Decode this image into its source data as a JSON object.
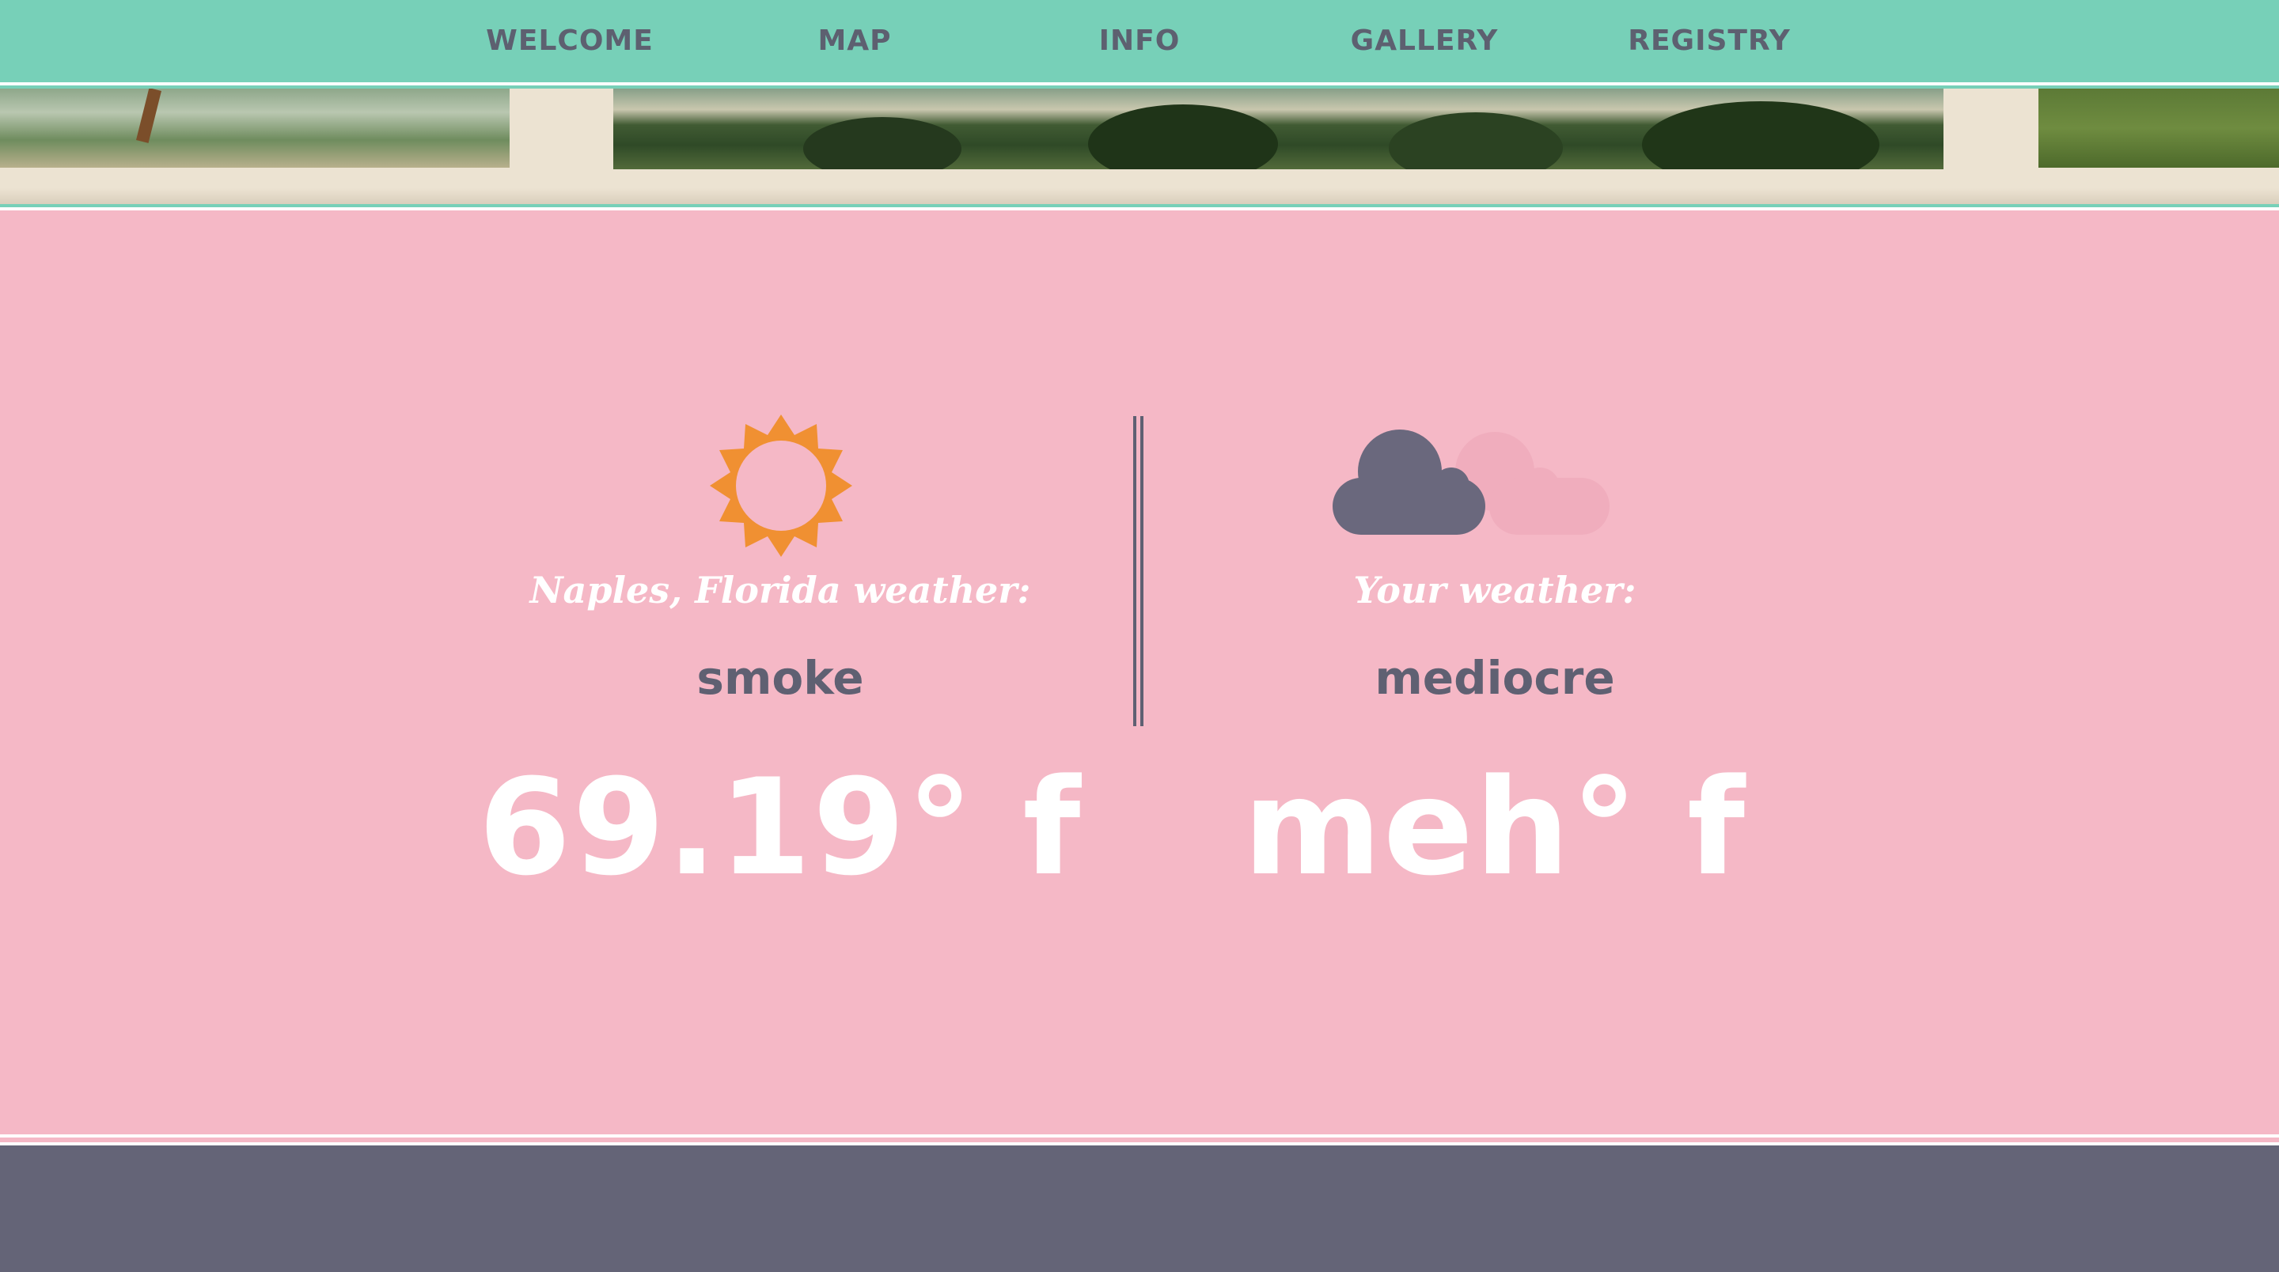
{
  "nav": {
    "items": [
      {
        "label": "WELCOME"
      },
      {
        "label": "MAP"
      },
      {
        "label": "INFO"
      },
      {
        "label": "GALLERY"
      },
      {
        "label": "REGISTRY"
      }
    ]
  },
  "weather": {
    "local": {
      "label": "Naples, Florida weather:",
      "condition": "smoke",
      "temperature": "69.19° f",
      "icon": "sun-icon"
    },
    "yours": {
      "label": "Your weather:",
      "condition": "mediocre",
      "temperature": "meh° f",
      "icon": "cloud-icon"
    }
  },
  "colors": {
    "nav_bg": "#77d0b8",
    "page_bg": "#f5b8c6",
    "footer_bg": "#646477",
    "text_dark": "#5f6072",
    "sun": "#f09032",
    "cloud_dark": "#6a687d",
    "cloud_light": "#f0adbd"
  }
}
